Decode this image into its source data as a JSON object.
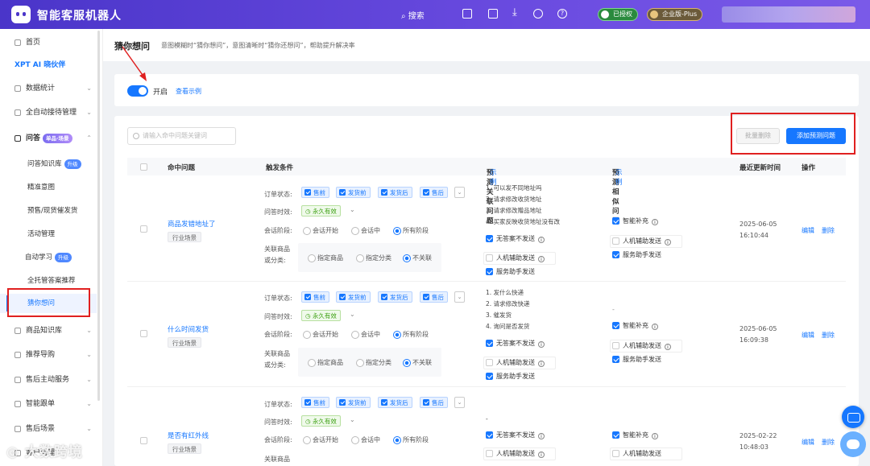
{
  "topbar": {
    "brand": "智能客服机器人",
    "search": "搜索",
    "badge_authorized": "已授权",
    "badge_edition": "企业版-Plus"
  },
  "sidebar": {
    "items": [
      {
        "label": "首页"
      },
      {
        "label": "XPT AI 晓伙伴"
      },
      {
        "label": "数据统计"
      },
      {
        "label": "全自动接待管理"
      },
      {
        "label": "问答",
        "tag": "单品·场景"
      },
      {
        "label": "商品知识库"
      },
      {
        "label": "推荐导购"
      },
      {
        "label": "售后主动服务"
      },
      {
        "label": "智能跟单"
      },
      {
        "label": "售后场景"
      },
      {
        "label": "客户管理"
      }
    ],
    "sub": [
      {
        "label": "问答知识库",
        "tag": "升级"
      },
      {
        "label": "精准意图"
      },
      {
        "label": "预售/现货催发货"
      },
      {
        "label": "活动管理"
      },
      {
        "label": "自动学习",
        "tag": "升级"
      },
      {
        "label": "全托管答案推荐"
      },
      {
        "label": "猜你想问"
      }
    ]
  },
  "header": {
    "title": "猜你想问",
    "desc": "意图模糊时“猜你想问”，意图清晰时“猜你还想问”，帮助提升解决率"
  },
  "toggle": {
    "label": "开启",
    "link": "查看示例"
  },
  "toolbar": {
    "search_placeholder": "请输入命中问题关键词",
    "batch_delete": "批量删除",
    "add": "添加预测问题"
  },
  "table": {
    "headers": {
      "question": "命中问题",
      "trigger": "触发条件",
      "related": "预测关联问题",
      "related_link": "示例",
      "similar": "预测相似问题",
      "similar_link": "示例",
      "updated": "最近更新时间",
      "ops": "操作"
    },
    "labels": {
      "order_status": "订单状态:",
      "ask_time": "问答时效:",
      "stage": "会话阶段:",
      "goods1": "关联商品",
      "goods2": "或分类:"
    },
    "status_opts": [
      "售前",
      "发货前",
      "发货后",
      "售后"
    ],
    "time_opt": "永久有效",
    "stage_opts": [
      "会话开始",
      "会话中",
      "所有阶段"
    ],
    "goods_opts": [
      "指定商品",
      "指定分类",
      "不关联"
    ],
    "ck_labels": {
      "no_answer": "无答案不发送",
      "human": "人机辅助发送",
      "assistant": "服务助手发送",
      "smart": "智能补充"
    },
    "ops": {
      "edit": "编辑",
      "delete": "删除"
    },
    "rows": [
      {
        "question": "商品发错地址了",
        "tag": "行业场景",
        "related": [
          "1. 可以发不同地址吗",
          "2. 请求修改收货地址",
          "3. 请求修改赠品地址",
          "4. 买家反映收货地址没有改"
        ],
        "similar": "-",
        "date": "2025-06-05",
        "time": "16:10:44"
      },
      {
        "question": "什么时间发货",
        "tag": "行业场景",
        "related": [
          "1. 发什么快递",
          "2. 请求修改快递",
          "3. 催发货",
          "4. 询问是否发货"
        ],
        "similar": "-",
        "date": "2025-06-05",
        "time": "16:09:38"
      },
      {
        "question": "是否有红外线",
        "tag": "行业场景",
        "related": [
          "-"
        ],
        "similar": "",
        "date": "2025-02-22",
        "time": "10:48:03"
      }
    ]
  },
  "watermark": "大数跨境",
  "colors": {
    "accent": "#1677ff",
    "topbar": "#5a40d8",
    "highlight": "#e02020"
  }
}
